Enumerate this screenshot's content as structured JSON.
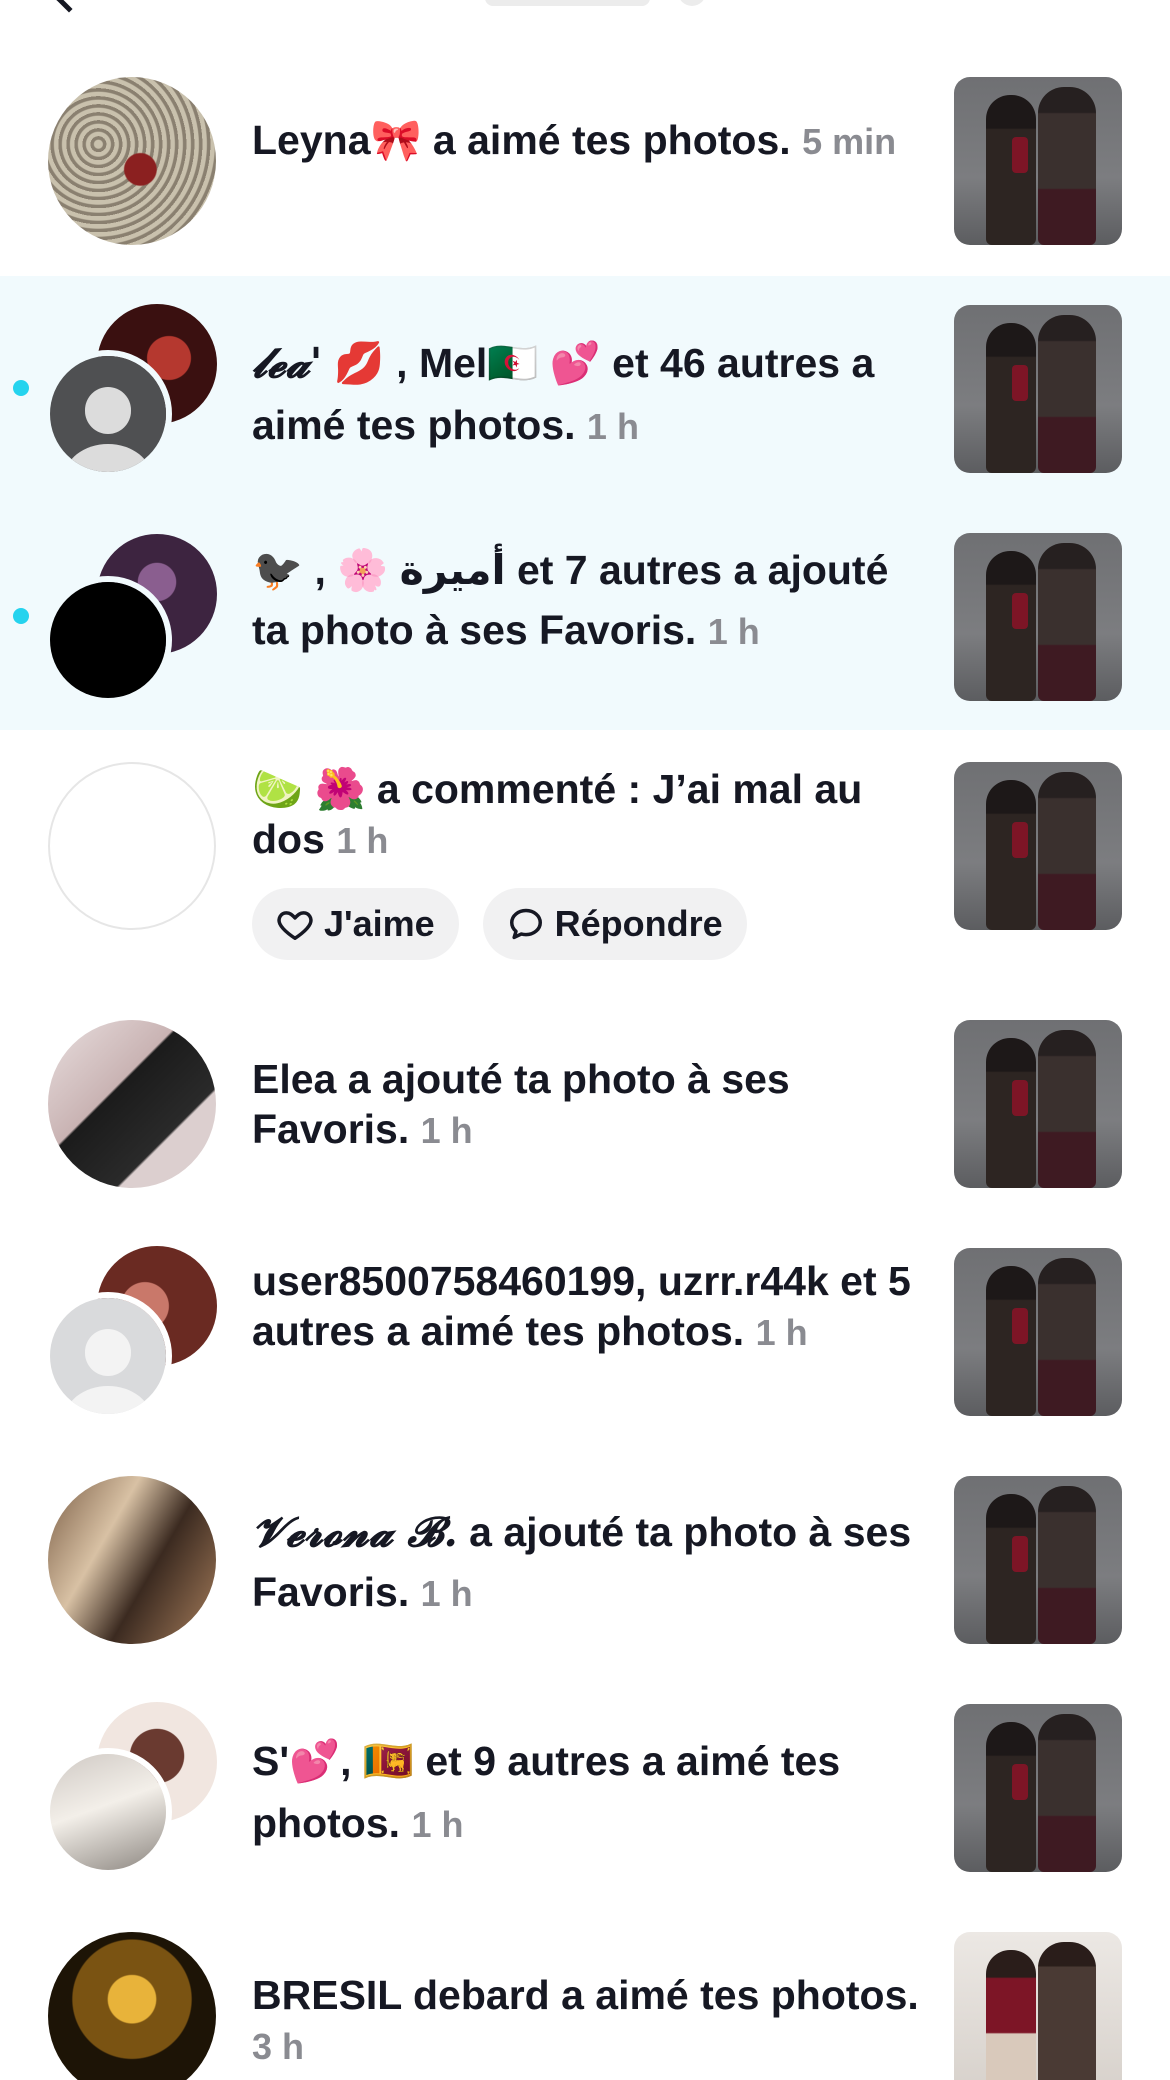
{
  "notifications": [
    {
      "text": "Leyna🎀 a aimé tes photos.",
      "time": "5 min",
      "unread": false
    },
    {
      "text_script": "𝓵𝓮𝓪'",
      "text": " 💋 , Mel🇩🇿 💕 et 46 autres a aimé tes photos.",
      "time": "1 h",
      "unread": true
    },
    {
      "text": "🐦‍⬛ , 🌸 أميرة et 7 autres a ajouté ta photo à ses Favoris.",
      "time": "1 h",
      "unread": true
    },
    {
      "text": "🍋‍🟩 🌺 a commenté : J’ai mal au dos",
      "time": "1 h",
      "unread": false,
      "like_label": "J'aime",
      "reply_label": "Répondre"
    },
    {
      "text": "Elea a ajouté ta photo à ses Favoris.",
      "time": "1 h",
      "unread": false
    },
    {
      "text": "user8500758460199, uzrr.r44k et 5 autres a aimé tes photos.",
      "time": "1 h",
      "unread": false
    },
    {
      "text_script": "𝓥𝓮𝓻𝓸𝓷𝓪 𝓑.",
      "text": " a ajouté ta photo à ses Favoris.",
      "time": "1 h",
      "unread": false
    },
    {
      "text": "S'💕, 🇱🇰 et 9 autres a aimé tes photos.",
      "time": "1 h",
      "unread": false
    },
    {
      "text": "BRESIL debard a aimé tes photos.",
      "time": "3 h",
      "unread": false
    }
  ],
  "colors": {
    "unread_background": "#f1fafd",
    "unread_dot": "#25d3ee",
    "time_grey": "#8a8b91",
    "pill_background": "#f1f1f2"
  },
  "icons": {
    "back": "chevron-left-icon",
    "like": "heart-outline-icon",
    "reply": "speech-bubble-icon"
  }
}
